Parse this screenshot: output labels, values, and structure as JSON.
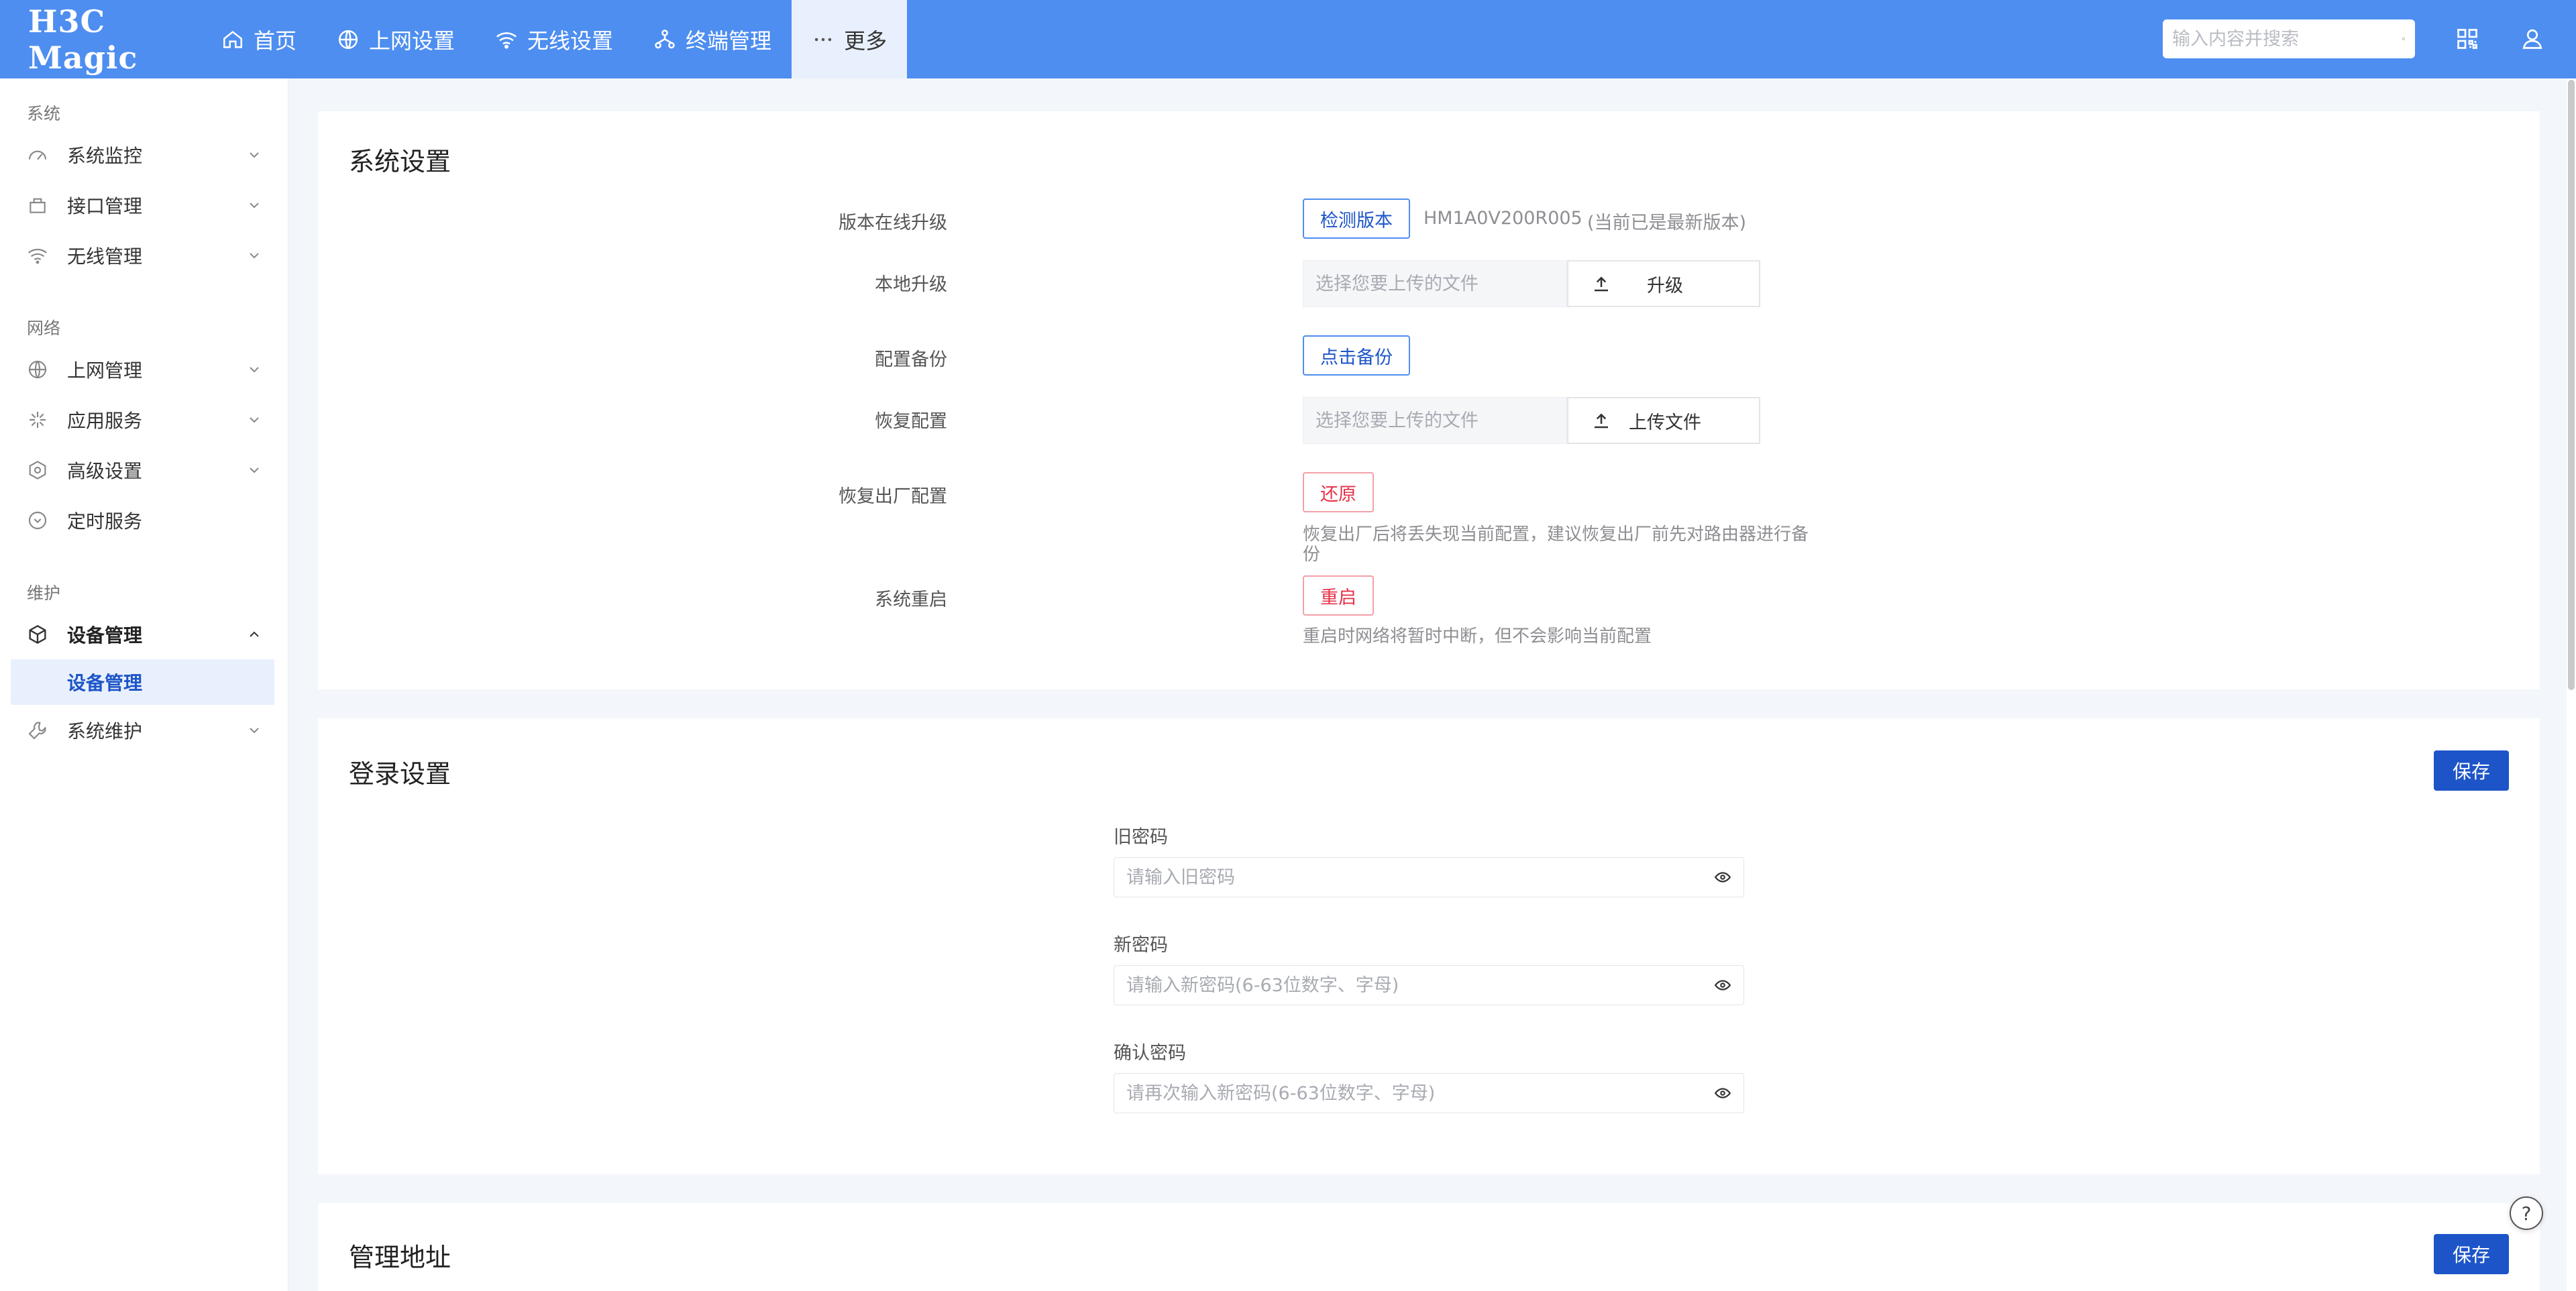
{
  "header": {
    "logo_text": "H3C Magic",
    "nav": [
      {
        "label": "首页",
        "icon": "home-icon"
      },
      {
        "label": "上网设置",
        "icon": "globe-icon"
      },
      {
        "label": "无线设置",
        "icon": "wifi-icon"
      },
      {
        "label": "终端管理",
        "icon": "devices-icon"
      },
      {
        "label": "更多",
        "icon": "more-icon"
      }
    ],
    "search_placeholder": "输入内容并搜索",
    "accent": "#4e8ef0"
  },
  "sidebar": {
    "groups": [
      {
        "title": "系统",
        "items": [
          {
            "label": "系统监控",
            "icon": "gauge-icon"
          },
          {
            "label": "接口管理",
            "icon": "interface-icon"
          },
          {
            "label": "无线管理",
            "icon": "wifi-icon"
          }
        ]
      },
      {
        "title": "网络",
        "items": [
          {
            "label": "上网管理",
            "icon": "globe-icon"
          },
          {
            "label": "应用服务",
            "icon": "apps-icon"
          },
          {
            "label": "高级设置",
            "icon": "hexagon-gear-icon"
          },
          {
            "label": "定时服务",
            "icon": "clock-icon"
          }
        ]
      },
      {
        "title": "维护",
        "items": [
          {
            "label": "设备管理",
            "icon": "cube-icon",
            "sub": "设备管理"
          },
          {
            "label": "系统维护",
            "icon": "wrench-icon"
          }
        ]
      }
    ]
  },
  "system_settings": {
    "title": "系统设置",
    "online_upgrade_label": "版本在线升级",
    "check_version_btn": "检测版本",
    "version": "HM1A0V200R005",
    "version_status": "(当前已是最新版本)",
    "local_upgrade_label": "本地升级",
    "file_placeholder": "选择您要上传的文件",
    "upgrade_btn": "升级",
    "backup_label": "配置备份",
    "backup_btn": "点击备份",
    "restore_label": "恢复配置",
    "upload_btn": "上传文件",
    "factory_label": "恢复出厂配置",
    "factory_btn": "还原",
    "factory_hint": "恢复出厂后将丢失现当前配置，建议恢复出厂前先对路由器进行备份",
    "reboot_label": "系统重启",
    "reboot_btn": "重启",
    "reboot_hint": "重启时网络将暂时中断，但不会影响当前配置"
  },
  "login_settings": {
    "title": "登录设置",
    "save_btn": "保存",
    "old_label": "旧密码",
    "old_placeholder": "请输入旧密码",
    "new_label": "新密码",
    "new_placeholder": "请输入新密码(6-63位数字、字母)",
    "confirm_label": "确认密码",
    "confirm_placeholder": "请再次输入新密码(6-63位数字、字母)"
  },
  "manage_address": {
    "title": "管理地址",
    "save_btn": "保存"
  },
  "help_icon": "?"
}
